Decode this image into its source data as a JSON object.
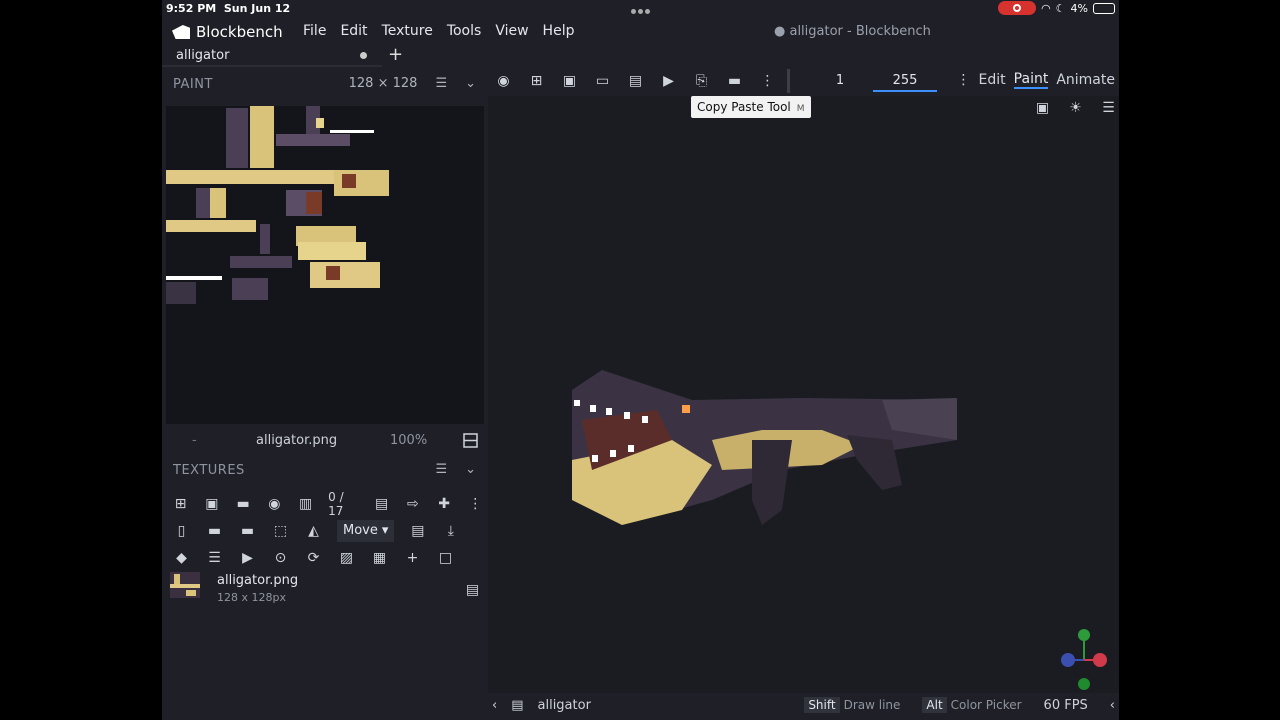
{
  "status": {
    "time": "9:52 PM",
    "date": "Sun Jun 12",
    "battery": "4%"
  },
  "app": {
    "name": "Blockbench",
    "window_title": "● alligator - Blockbench"
  },
  "menu": {
    "items": [
      "File",
      "Edit",
      "Texture",
      "Tools",
      "View",
      "Help"
    ]
  },
  "tabs": [
    {
      "label": "alligator"
    }
  ],
  "paint_panel": {
    "title": "PAINT",
    "texture_size": "128 × 128",
    "tex_file": "alligator.png",
    "zoom": "100%",
    "left_mark": "-"
  },
  "textures_panel": {
    "title": "TEXTURES",
    "counter": "0 / 17",
    "mode_select": "Move"
  },
  "texture_item": {
    "name": "alligator.png",
    "size": "128 x 128px"
  },
  "toolbar": {
    "value1": "1",
    "value2": "255"
  },
  "modes": {
    "edit": "Edit",
    "paint": "Paint",
    "animate": "Animate"
  },
  "tooltip": {
    "text": "Copy Paste Tool",
    "shortcut": "M"
  },
  "bottom": {
    "model_name": "alligator",
    "key1": "Shift",
    "hint1": "Draw line",
    "key2": "Alt",
    "hint2": "Color Picker",
    "fps": "60 FPS"
  },
  "colors": {
    "accent": "#3e90ff",
    "background": "#1f2027",
    "viewport": "#1b1c22"
  }
}
